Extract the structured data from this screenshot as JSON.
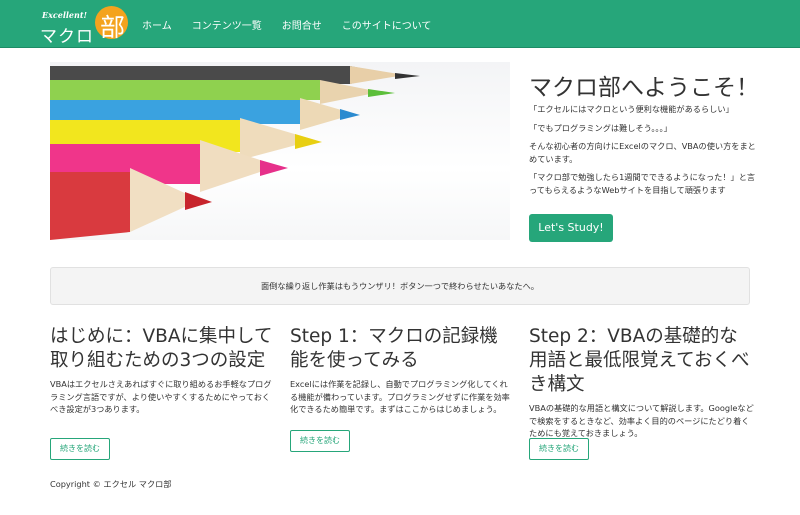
{
  "nav": {
    "logo_small": "Excellent!",
    "logo_main": "マクロ",
    "logo_kanji": "部",
    "links": [
      "ホーム",
      "コンテンツ一覧",
      "お問合せ",
      "このサイトについて"
    ]
  },
  "hero": {
    "title": "マクロ部へようこそ！",
    "lines": [
      "「エクセルにはマクロという便利な機能があるらしい」",
      "「でもプログラミングは難しそう。。。」",
      "そんな初心者の方向けにExcelのマクロ、VBAの使い方をまとめています。",
      "「マクロ部で勉強したら1週間でできるようになった！」と言ってもらえるようなWebサイトを目指して頑張ります"
    ],
    "button": "Let's Study!"
  },
  "well": {
    "text": "面倒な繰り返し作業はもうウンザリ！ボタン一つで終わらせたいあなたへ。"
  },
  "columns": [
    {
      "title": "はじめに：VBAに集中して取り組むための3つの設定",
      "text": "VBAはエクセルさえあればすぐに取り組めるお手軽なプログラミング言語ですが、より使いやすくするためにやっておくべき設定が3つあります。",
      "button": "続きを読む"
    },
    {
      "title": "Step 1：マクロの記録機能を使ってみる",
      "text": "Excelには作業を記録し、自動でプログラミング化してくれる機能が備わっています。プログラミングせずに作業を効率化できるため簡単です。まずはここからはじめましょう。",
      "button": "続きを読む"
    },
    {
      "title": "Step 2：VBAの基礎的な用語と最低限覚えておくべき構文",
      "text": "VBAの基礎的な用語と構文について解説します。Googleなどで検索をするときなど、効率よく目的のページにたどり着くためにも覚えておきましょう。",
      "button": "続きを読む"
    }
  ],
  "footer": {
    "text": "Copyright © エクセル マクロ部"
  },
  "colors": {
    "accent": "#26a67a",
    "logo_orange": "#f4a31e"
  }
}
